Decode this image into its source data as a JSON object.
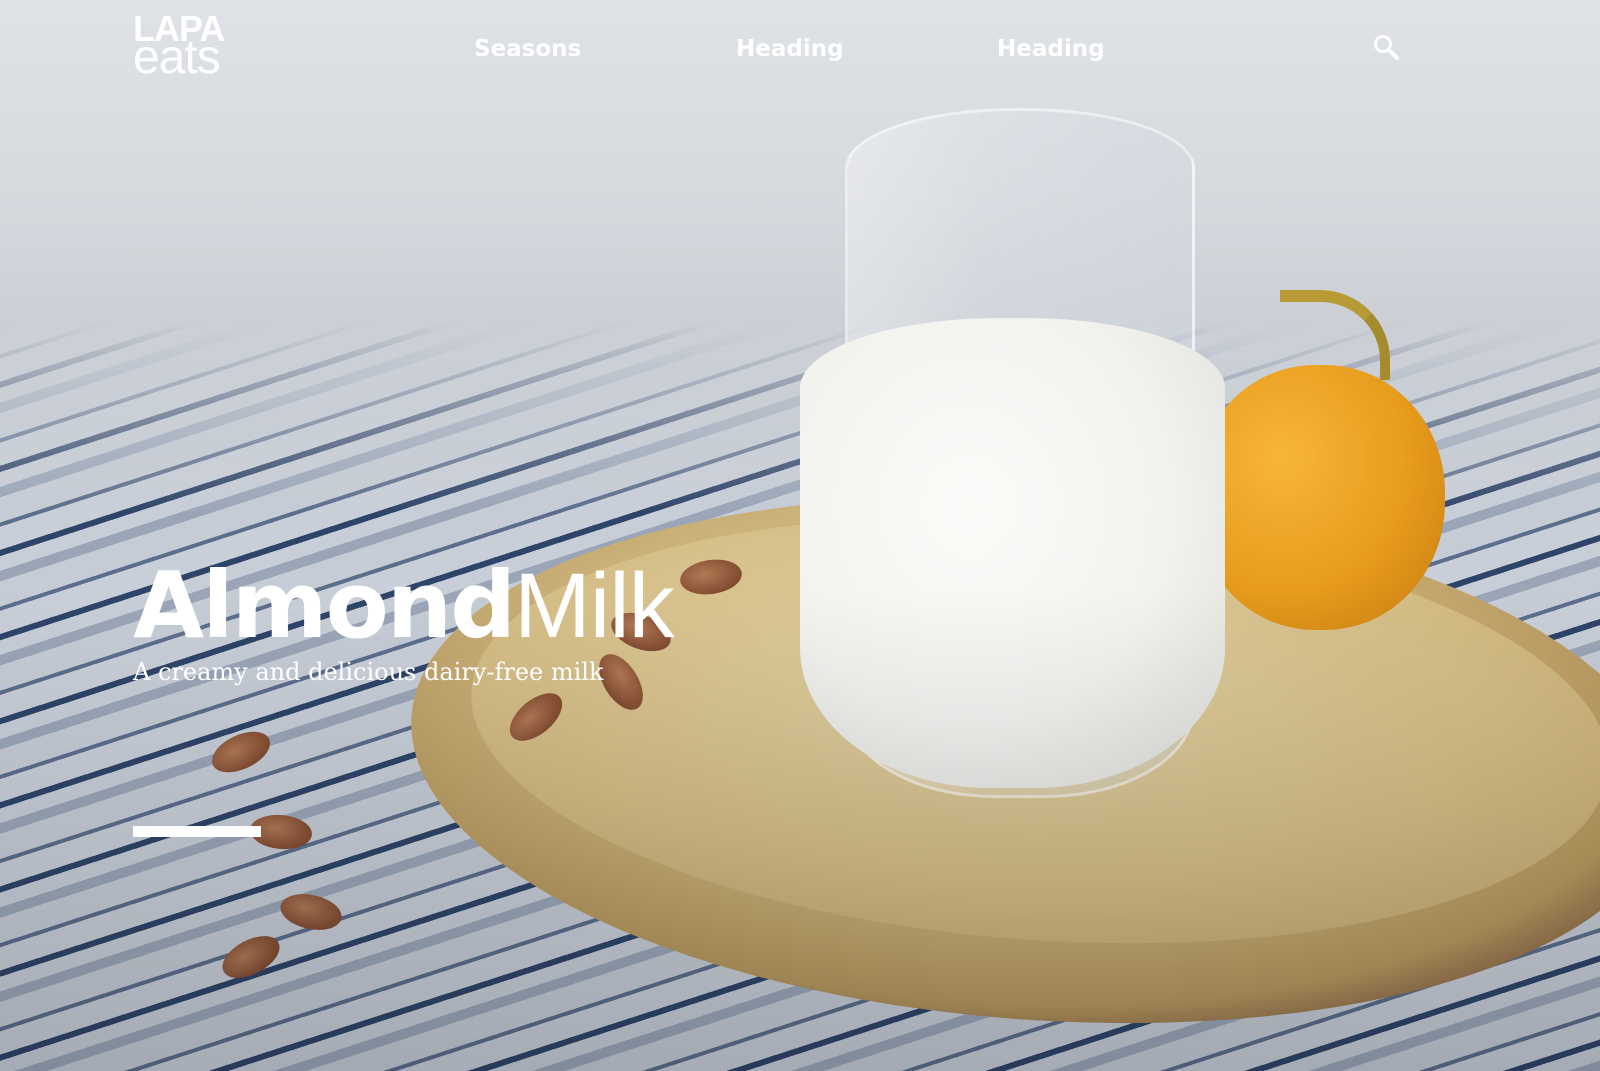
{
  "logo": {
    "top": "LAPA",
    "bottom": "eats"
  },
  "nav": {
    "items": [
      {
        "label": "Seasons"
      },
      {
        "label": "Heading"
      },
      {
        "label": "Heading"
      }
    ],
    "search_icon": "search-icon"
  },
  "hero": {
    "title_bold": "Almond",
    "title_light": "Milk",
    "subtitle": "A creamy and delicious dairy-free milk",
    "image": "milk-jug-photo"
  },
  "colors": {
    "text": "#ffffff",
    "accent": "#ffffff",
    "pumpkin": "#e79c1c",
    "board": "#cbb27a"
  }
}
